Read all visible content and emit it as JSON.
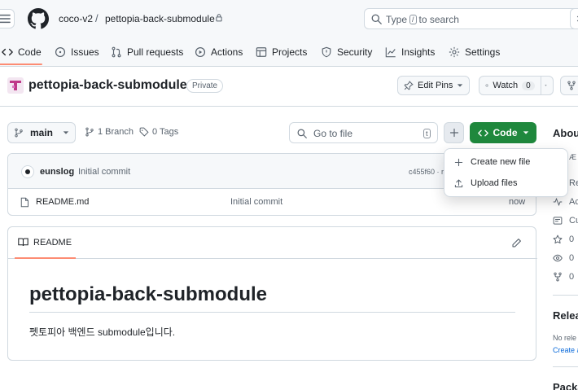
{
  "header": {
    "owner": "coco-v2",
    "separator": "/",
    "repo": "pettopia-back-submodule",
    "search_before": "Type",
    "search_key": "/",
    "search_after": "to search"
  },
  "nav": {
    "code": "Code",
    "issues": "Issues",
    "pull_requests": "Pull requests",
    "actions": "Actions",
    "projects": "Projects",
    "security": "Security",
    "insights": "Insights",
    "settings": "Settings"
  },
  "repo": {
    "title": "pettopia-back-submodule",
    "visibility": "Private",
    "edit_pins": "Edit Pins",
    "watch": "Watch",
    "watch_count": "0"
  },
  "toolbar": {
    "branch": "main",
    "branch_count": "1 Branch",
    "tag_count": "0 Tags",
    "goto_placeholder": "Go to file",
    "goto_key": "t",
    "code_button": "Code"
  },
  "commit": {
    "author": "eunslog",
    "message": "Initial commit",
    "sha": "c455f60 · r"
  },
  "files": [
    {
      "name": "README.md",
      "message": "Initial commit",
      "time": "now"
    }
  ],
  "readme": {
    "tab": "README",
    "heading": "pettopia-back-submodule",
    "body": "펫토피아 백엔드 submodule입니다."
  },
  "dropdown": {
    "create": "Create new file",
    "upload": "Upload files"
  },
  "sidebar": {
    "about": "About",
    "about_desc": "Æ I",
    "rows": [
      "Re",
      "Ac",
      "Cu",
      "0",
      "0",
      "0"
    ],
    "releases": "Relea",
    "no_releases": "No rele",
    "create_release": "Create a",
    "packages": "Packa"
  },
  "colors": {
    "accent_orange": "#fd8c73",
    "primary_green": "#1f883d",
    "link_blue": "#0969da",
    "repo_avatar": "#bf3989"
  }
}
